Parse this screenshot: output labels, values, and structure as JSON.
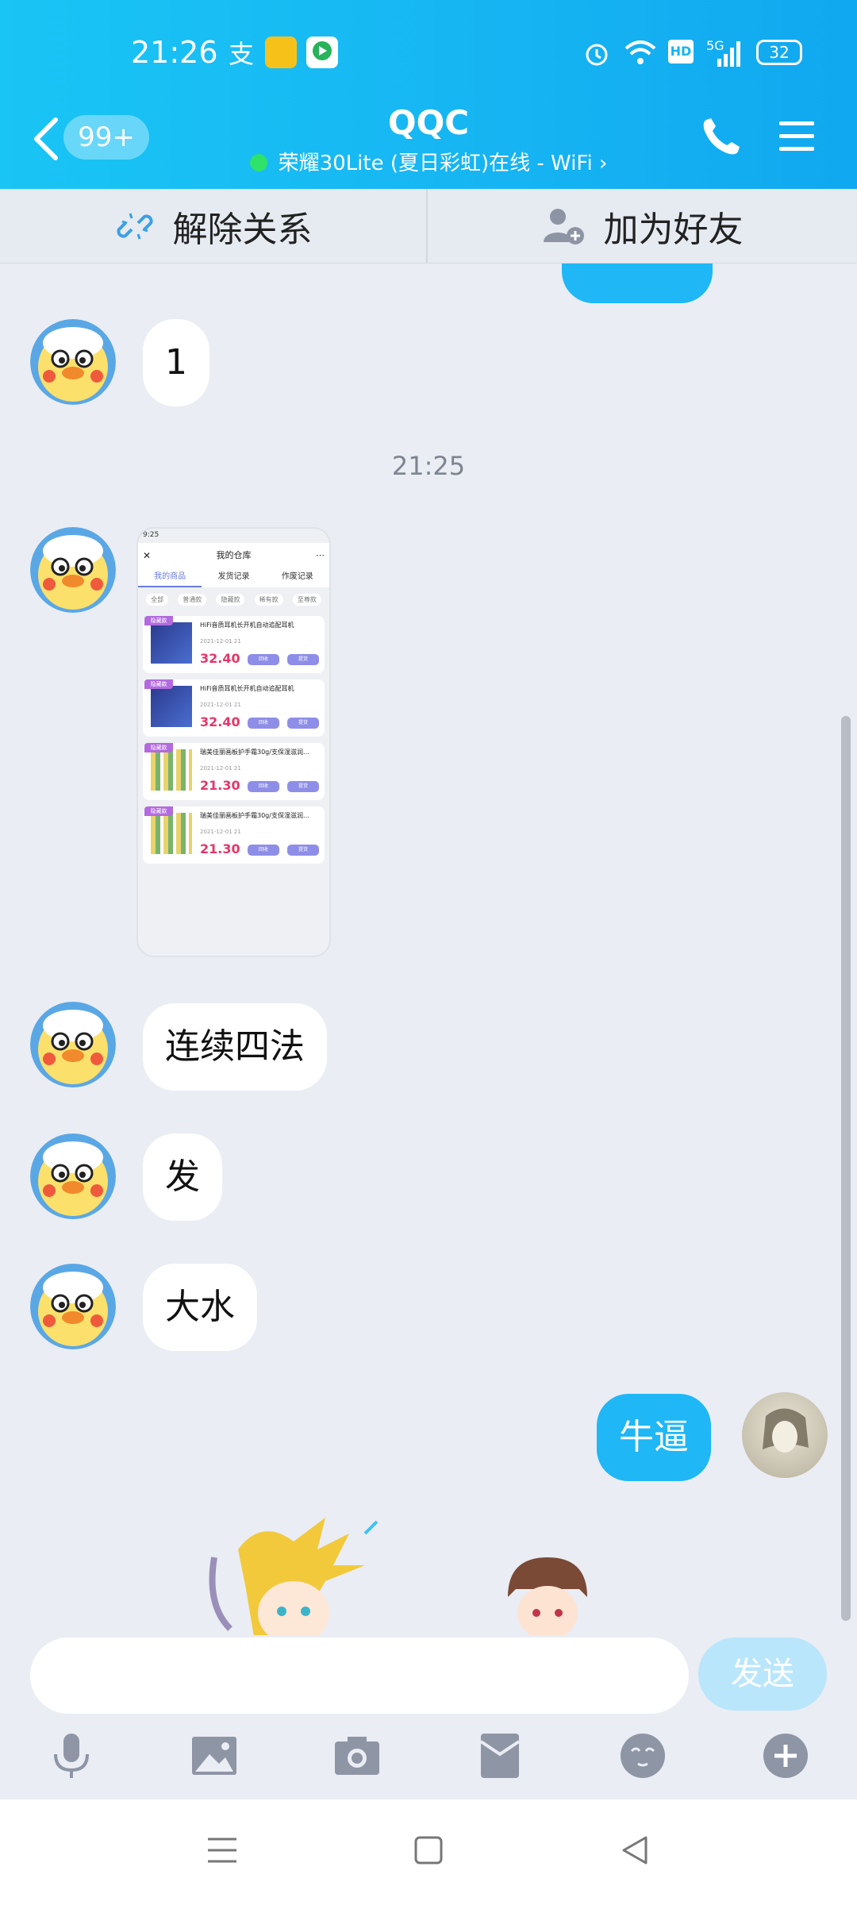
{
  "status_bar": {
    "time": "21:26",
    "battery": "32",
    "network": "5G",
    "hd": "HD"
  },
  "header": {
    "unread_badge": "99+",
    "title": "QQC",
    "subtitle": "荣耀30Lite (夏日彩虹)在线 - WiFi ›"
  },
  "actions": {
    "unbind": "解除关系",
    "add_friend": "加为好友"
  },
  "messages": {
    "m1": "1",
    "timestamp": "21:25",
    "m2": "连续四法",
    "m3": "发",
    "m4": "大水",
    "me1": "牛逼"
  },
  "shared_screenshot": {
    "status_left": "9:25",
    "title": "我的仓库",
    "tabs": [
      "我的商品",
      "发货记录",
      "作废记录"
    ],
    "filters": [
      "全部",
      "普通款",
      "隐藏款",
      "稀有款",
      "至尊款"
    ],
    "items": [
      {
        "tag": "隐藏款",
        "name": "HiFi音质耳机长开机自动追配耳机",
        "date": "2021-12-01 21",
        "price": "32.40",
        "btn1": "回收",
        "btn2": "提货"
      },
      {
        "tag": "隐藏款",
        "name": "HiFi音质耳机长开机自动追配耳机",
        "date": "2021-12-01 21",
        "price": "32.40",
        "btn1": "回收",
        "btn2": "提货"
      },
      {
        "tag": "隐藏款",
        "name": "瑞美佳丽画板护手霜30g/支保湿滋润…",
        "date": "2021-12-01 21",
        "price": "21.30",
        "btn1": "回收",
        "btn2": "提货"
      },
      {
        "tag": "隐藏款",
        "name": "瑞美佳丽画板护手霜30g/支保湿滋润…",
        "date": "2021-12-01 21",
        "price": "21.30",
        "btn1": "回收",
        "btn2": "提货"
      }
    ]
  },
  "input": {
    "placeholder": "",
    "send_label": "发送"
  },
  "colors": {
    "header": "#16b4f2",
    "my_bubble": "#1fb7f5",
    "background": "#eaedf4"
  }
}
